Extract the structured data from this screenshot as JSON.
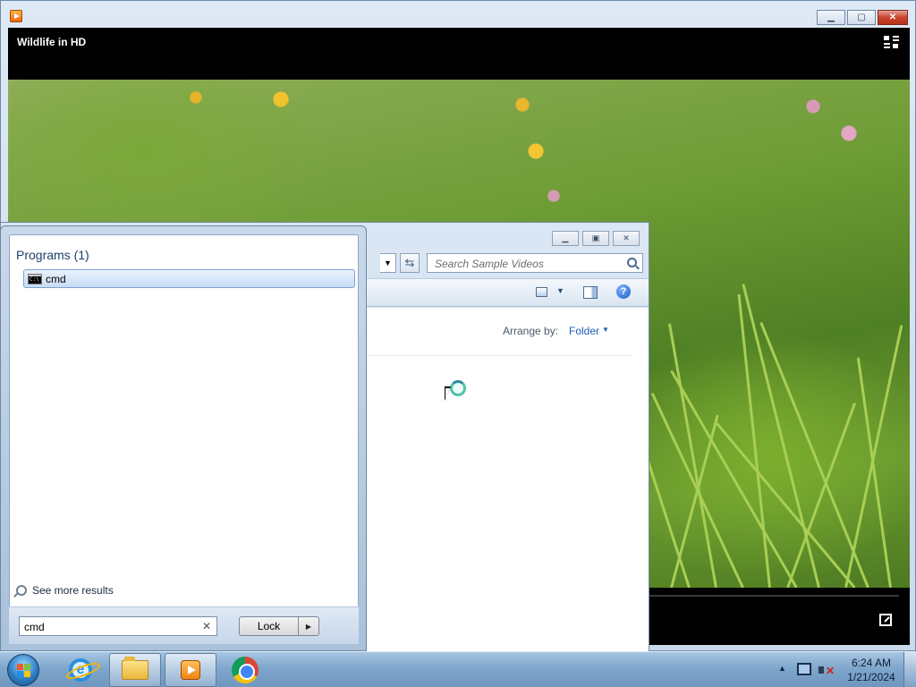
{
  "media_player": {
    "title": "Wildlife in HD"
  },
  "explorer": {
    "search_placeholder": "Search Sample Videos",
    "arrange_label": "Arrange by:",
    "arrange_value": "Folder"
  },
  "start_menu": {
    "programs_header": "Programs (1)",
    "results": [
      {
        "label": "cmd",
        "icon": "cmd-icon",
        "selected": true
      }
    ],
    "see_more": "See more results",
    "search_value": "cmd",
    "lock_label": "Lock"
  },
  "taskbar": {
    "pinned": [
      "internet-explorer-icon",
      "folder-icon",
      "media-player-icon",
      "chrome-icon"
    ],
    "clock_time": "6:24 AM",
    "clock_date": "1/21/2024"
  }
}
